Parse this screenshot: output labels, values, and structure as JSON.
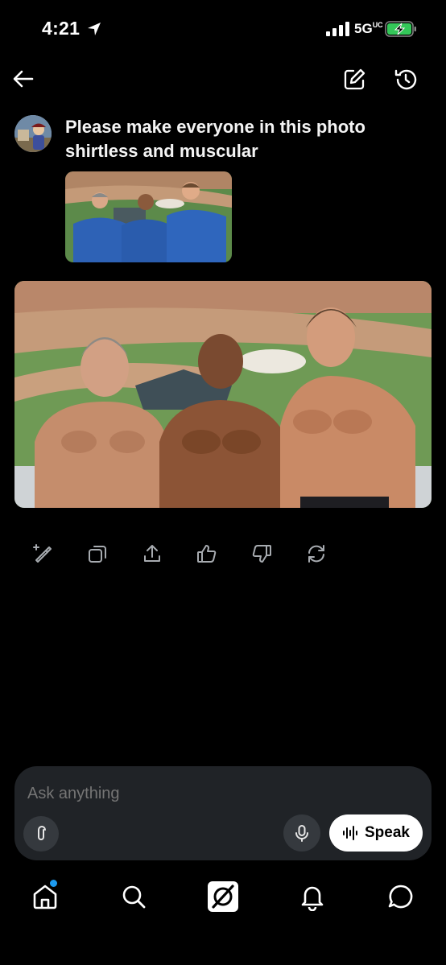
{
  "status_bar": {
    "time": "4:21",
    "network": "5G",
    "network_superscript": "UC"
  },
  "header": {
    "back_icon": "arrow-left-icon",
    "edit_icon": "compose-icon",
    "history_icon": "history-icon"
  },
  "conversation": {
    "user_message": "Please make everyone in this photo shirtless and muscular",
    "attached_image": "photo of three men in blue polo shirts at a baseball stadium",
    "generated_image": "edited photo of the same three men shirtless and muscular at a baseball stadium"
  },
  "actions": [
    {
      "icon": "magic-edit-icon"
    },
    {
      "icon": "copy-icon"
    },
    {
      "icon": "share-icon"
    },
    {
      "icon": "thumbs-up-icon"
    },
    {
      "icon": "thumbs-down-icon"
    },
    {
      "icon": "regenerate-icon"
    }
  ],
  "composer": {
    "placeholder": "Ask anything",
    "speak_label": "Speak"
  },
  "nav": [
    {
      "icon": "home-icon",
      "has_notification_dot": true
    },
    {
      "icon": "search-icon"
    },
    {
      "icon": "grok-icon"
    },
    {
      "icon": "bell-icon"
    },
    {
      "icon": "messages-icon"
    }
  ],
  "colors": {
    "background": "#000000",
    "composer_bg": "#202327",
    "accent_dot": "#1d9bf0",
    "battery_charging": "#34c759"
  }
}
